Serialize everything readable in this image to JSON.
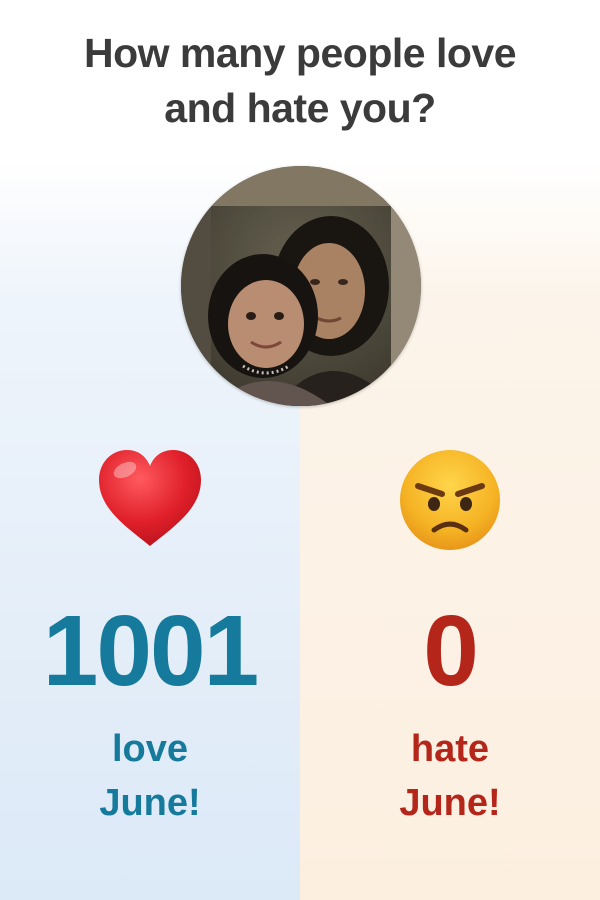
{
  "title": {
    "line1": "How many people love",
    "line2": "and hate you?"
  },
  "avatar": {
    "icon": "profile-photo"
  },
  "love": {
    "icon": "red-heart-icon",
    "count": "1001",
    "label_line1": "love",
    "label_line2": "June!",
    "color": "#157a9b"
  },
  "hate": {
    "icon": "angry-face-icon",
    "count": "0",
    "label_line1": "hate",
    "label_line2": "June!",
    "color": "#b5261a"
  }
}
